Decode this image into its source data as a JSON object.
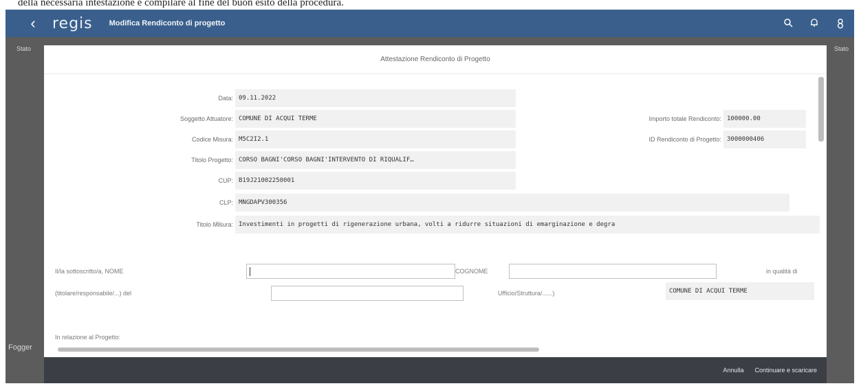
{
  "caption": "della necessaria intestazione e compilare al fine del buon esito della procedura.",
  "shell": {
    "logo": "regis",
    "title": "Modifica Rendiconto di progetto",
    "icons": [
      "back-icon",
      "search-icon",
      "bell-icon",
      "user-icon"
    ]
  },
  "background": {
    "left_top": "Stato",
    "right_top": "Stato",
    "left_bottom": "Fogger"
  },
  "dialog": {
    "title": "Attestazione Rendiconto di Progetto",
    "fields": {
      "data_label": "Data:",
      "data_value": "09.11.2022",
      "soggetto_label": "Soggetto Attuatore:",
      "soggetto_value": "COMUNE DI ACQUI TERME",
      "codice_label": "Codice Misura:",
      "codice_value": "M5C2I2.1",
      "titolo_label": "Titolo Progetto:",
      "titolo_value": "CORSO BAGNI'CORSO BAGNI'INTERVENTO DI RIQUALIF…",
      "cup_label": "CUP:",
      "cup_value": "B19J21002250001",
      "clp_label": "CLP:",
      "clp_value": "MNGDAPV300356",
      "titolo_misura_label": "Titolo Misura:",
      "titolo_misura_value": "Investimenti in progetti di rigenerazione urbana, volti a ridurre situazioni di emarginazione e degra",
      "importo_label": "Importo totale Rendiconto:",
      "importo_value": "100000.00",
      "id_label": "ID Rendiconto di Progetto:",
      "id_value": "3000000406"
    },
    "form": {
      "nome_label": "Il/la sottoscritto/a, NOME",
      "cognome_label": "COGNOME",
      "qualita_label": "in qualità di",
      "titolare_label": "(titolare/responsabile/...) del",
      "ufficio_label": "Ufficio/Struttura/......)",
      "ente_value": "COMUNE DI ACQUI TERME",
      "relazione_label": "In relazione al Progetto:"
    }
  },
  "footer": {
    "cancel": "Annulla",
    "continue": "Continuare e scaricare"
  }
}
